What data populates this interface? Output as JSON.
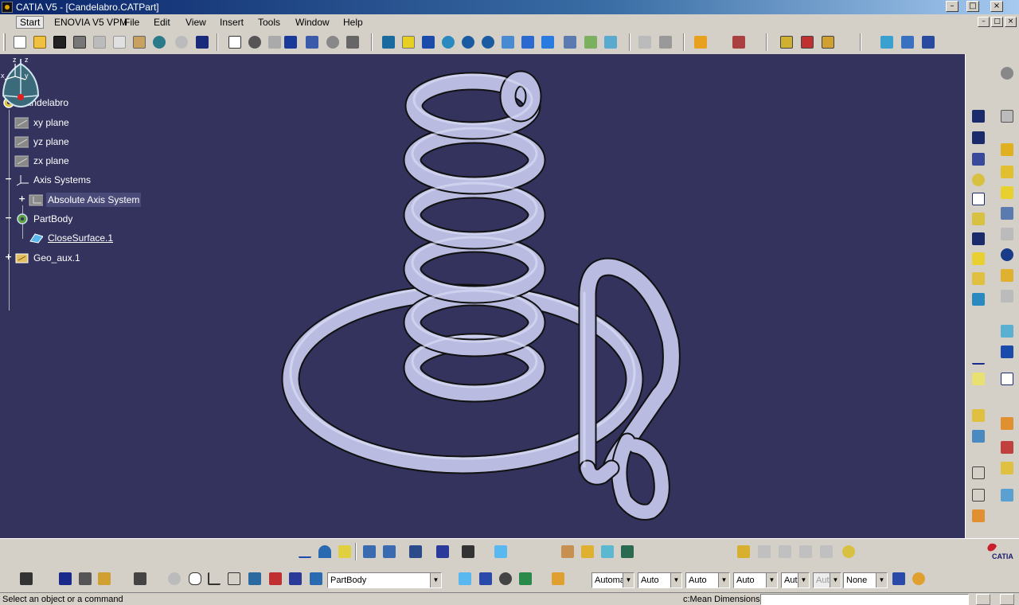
{
  "window": {
    "title": "CATIA V5 - [Candelabro.CATPart]",
    "minimize_glyph": "–",
    "maximize_glyph": "□",
    "close_glyph": "×"
  },
  "menu": {
    "items": [
      "Start",
      "ENOVIA V5 VPM",
      "File",
      "Edit",
      "View",
      "Insert",
      "Tools",
      "Window",
      "Help"
    ],
    "active": "Start"
  },
  "tree": {
    "root": "Candelabro",
    "items": [
      {
        "label": "xy plane",
        "icon": "plane-icon"
      },
      {
        "label": "yz plane",
        "icon": "plane-icon"
      },
      {
        "label": "zx plane",
        "icon": "plane-icon"
      },
      {
        "label": "Axis Systems",
        "icon": "axis-systems-icon"
      },
      {
        "label": "Absolute Axis System",
        "icon": "axis-system-icon"
      },
      {
        "label": "PartBody",
        "icon": "partbody-icon"
      },
      {
        "label": "CloseSurface.1",
        "icon": "close-surface-icon"
      },
      {
        "label": "Geo_aux.1",
        "icon": "geometrical-set-icon"
      }
    ]
  },
  "compass": {
    "axis_label": "z",
    "mini_axis": {
      "z": "z",
      "x": "x",
      "y": "y"
    }
  },
  "bottom": {
    "body_select": "PartBody",
    "graphic_props": [
      "Automa",
      "Auto",
      "Auto",
      "Auto",
      "Aut",
      "Aut",
      "None"
    ],
    "dropdown_glyph": "▼"
  },
  "status": {
    "message": "Select an object or a command",
    "measure_label": "c:Mean Dimensions"
  },
  "brand": {
    "logo_text": "CATIA"
  },
  "colors": {
    "viewport_bg": "#33335e",
    "tube": "#b9bce0",
    "titlebar_start": "#0a246a",
    "compass_fill": "#3b6b7a"
  }
}
